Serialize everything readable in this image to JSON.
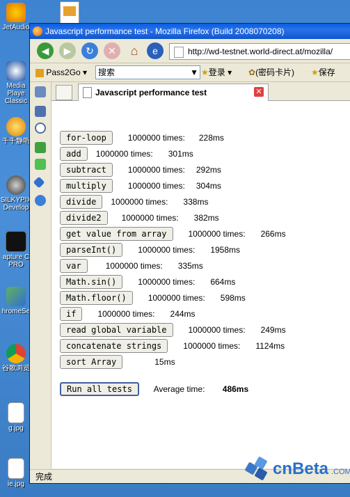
{
  "desktop": {
    "icons": [
      {
        "label": "JetAudio"
      },
      {
        "label": "Media Playe Classic"
      },
      {
        "label": "千千静听"
      },
      {
        "label": "SILKYPIX Develop"
      },
      {
        "label": "apture C PRO"
      },
      {
        "label": "hromeSe"
      },
      {
        "label": "谷歌浏览"
      },
      {
        "label": "g.jpg"
      },
      {
        "label": "ie.jpg"
      }
    ]
  },
  "window": {
    "title": "Javascript performance test - Mozilla Firefox (Build 2008070208)"
  },
  "navbar": {
    "url": "http://wd-testnet.world-direct.at/mozilla/"
  },
  "toolbar2": {
    "pass2go": "Pass2Go",
    "search_placeholder": "搜索",
    "login": "登录",
    "password_card": "(密码卡片)",
    "save": "保存"
  },
  "tab": {
    "title": "Javascript performance test"
  },
  "tests": [
    {
      "name": "for-loop",
      "times": "1000000 times:",
      "ms": "228ms"
    },
    {
      "name": "add",
      "times": "1000000 times:",
      "ms": "301ms"
    },
    {
      "name": "subtract",
      "times": "1000000 times:",
      "ms": "292ms"
    },
    {
      "name": "multiply",
      "times": "1000000 times:",
      "ms": "304ms"
    },
    {
      "name": "divide",
      "times": "1000000 times:",
      "ms": "338ms"
    },
    {
      "name": "divide2",
      "times": "1000000 times:",
      "ms": "382ms"
    },
    {
      "name": "get value from array",
      "times": "1000000 times:",
      "ms": "266ms"
    },
    {
      "name": "parseInt()",
      "times": "1000000 times:",
      "ms": "1958ms"
    },
    {
      "name": "var",
      "times": "1000000 times:",
      "ms": "335ms"
    },
    {
      "name": "Math.sin()",
      "times": "1000000 times:",
      "ms": "664ms"
    },
    {
      "name": "Math.floor()",
      "times": "1000000 times:",
      "ms": "598ms"
    },
    {
      "name": "if",
      "times": "1000000 times:",
      "ms": "244ms"
    },
    {
      "name": "read global variable",
      "times": "1000000 times:",
      "ms": "249ms"
    },
    {
      "name": "concatenate strings",
      "times": "1000000 times:",
      "ms": "1124ms"
    },
    {
      "name": "sort Array",
      "times": "",
      "ms": "15ms"
    }
  ],
  "summary": {
    "run_all": "Run all tests",
    "average_label": "Average time:",
    "average_value": "486ms"
  },
  "statusbar": {
    "text": "完成"
  },
  "watermark": {
    "text": "cnBeta",
    "suffix": ".COM"
  }
}
